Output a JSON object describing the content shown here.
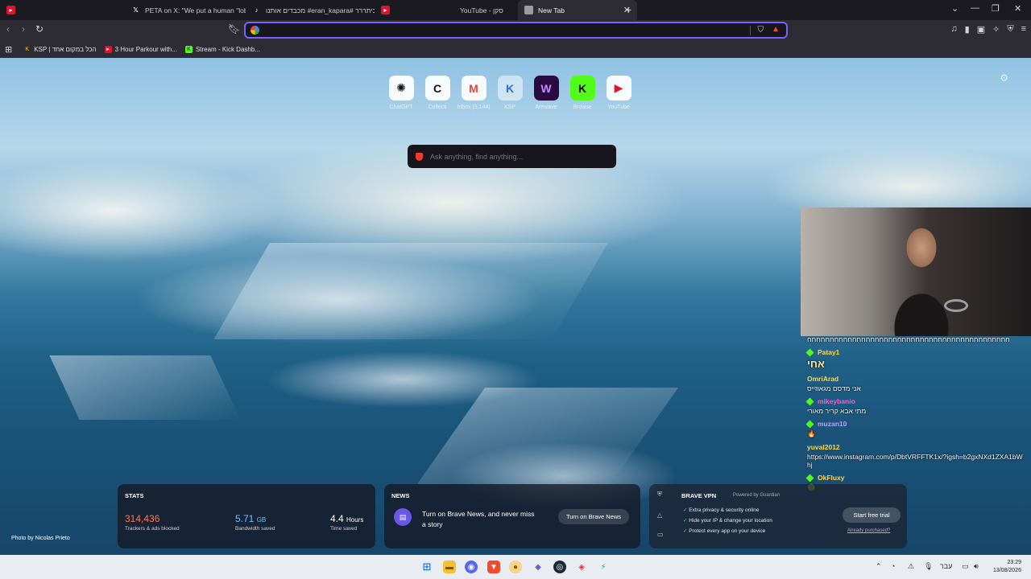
{
  "browser": {
    "tabs": [
      {
        "title": "",
        "favicon": "youtube-icon"
      },
      {
        "title": "PETA on X: \"We put a human \"lobste",
        "favicon": "x-icon"
      },
      {
        "title": "מכבדים אותנו #eran_kapara# ביתררר",
        "favicon": "tiktok-icon"
      },
      {
        "title": "",
        "favicon": "youtube-icon"
      },
      {
        "title": "YouTube - סקן",
        "favicon": "youtube-icon"
      },
      {
        "title": "New Tab",
        "favicon": "globe-icon",
        "active": true
      }
    ],
    "address_bar": {
      "value": "",
      "placeholder": ""
    },
    "bookmarks": [
      {
        "label": "KSP | הכל במקום אחד",
        "favicon": "ksp-icon"
      },
      {
        "label": "3 Hour Parkour with...",
        "favicon": "youtube-icon"
      },
      {
        "label": "Stream - Kick Dashb...",
        "favicon": "kick-icon"
      }
    ]
  },
  "newtab": {
    "top_sites": [
      {
        "label": "ChatGPT",
        "glyph": "✺",
        "color": "#111111"
      },
      {
        "label": "Collecti",
        "glyph": "C",
        "color": "#111111"
      },
      {
        "label": "Inbox (3,144)",
        "glyph": "M",
        "color": "#ea4335"
      },
      {
        "label": "KSP",
        "glyph": "K",
        "color": "#2d6cdf"
      },
      {
        "label": "Arewave",
        "glyph": "W",
        "color": "#8a2be2"
      },
      {
        "label": "Browse",
        "glyph": "K",
        "color": "#53fc18"
      },
      {
        "label": "YouTube",
        "glyph": "▶",
        "color": "#e0122d"
      }
    ],
    "search": {
      "placeholder": "Ask anything, find anything..."
    },
    "stats": {
      "title": "STATS",
      "trackers": {
        "value": "314,436",
        "label": "Trackers & ads blocked"
      },
      "bandwidth": {
        "value": "5.71",
        "unit": "GB",
        "label": "Bandwidth saved"
      },
      "time": {
        "value": "4.4",
        "unit": "Hours",
        "label": "Time saved"
      }
    },
    "news": {
      "title": "NEWS",
      "text": "Turn on Brave News, and never miss a story",
      "button": "Turn on Brave News"
    },
    "vpn": {
      "title": "BRAVE VPN",
      "powered": "Powered by Guardian",
      "features": [
        "Extra privacy & security online",
        "Hide your IP & change your location",
        "Protect every app on your device"
      ],
      "button": "Start free trial",
      "link": "Already purchased?"
    },
    "photo_credit": "Photo by Nicolas Prieto"
  },
  "chat": [
    {
      "user": "",
      "text": "חחחחחחחחחחחחחחחחחחחחחחחחחחחחחחחחחחחחחחחחחחחחח",
      "color": "#ffffff"
    },
    {
      "user": "Patay1",
      "text": "אחי",
      "color": "#ffd84a",
      "big": true
    },
    {
      "user": "OmriArad",
      "text": "אני מדסם מגאוזייס",
      "color": "#ffd84a"
    },
    {
      "user": "mikeybanio",
      "text": "מתי אבא קריר מאורי",
      "color": "#ff5ad1"
    },
    {
      "user": "muzan10",
      "text": "",
      "color": "#c79bff"
    },
    {
      "user": "yuval2012",
      "text": "https://www.instagram.com/p/DbtVRFFTK1x/?igsh=b2gxNXd1ZXA1bWhj",
      "color": "#ffd84a"
    },
    {
      "user": "OkFluxy",
      "text": "",
      "color": "#ffd84a"
    }
  ],
  "taskbar": {
    "language": "עבר",
    "time": "23:29",
    "date": "13/08/2026"
  }
}
